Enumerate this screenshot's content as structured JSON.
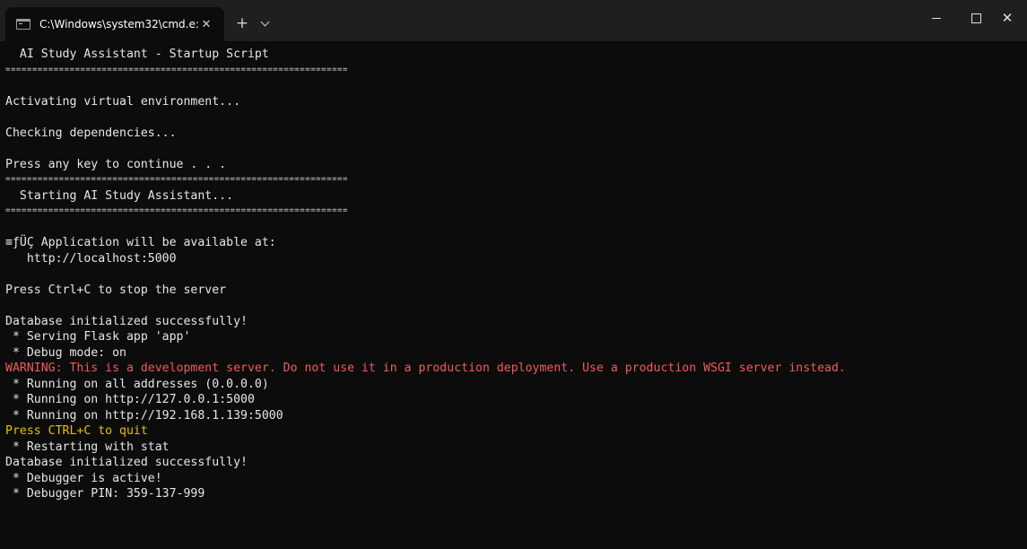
{
  "window": {
    "tab_title": "C:\\Windows\\system32\\cmd.e:",
    "close_tab_glyph": "✕",
    "new_tab_glyph": "+",
    "close_window_glyph": "✕"
  },
  "colors": {
    "background": "#0c0c0c",
    "titlebar": "#1f1f1f",
    "text": "#e6e6e6",
    "warning": "#f25a5a",
    "highlight": "#e5c000"
  },
  "console": {
    "lines": [
      "  AI Study Assistant - Startup Script",
      "================================================================",
      "",
      "Activating virtual environment...",
      "",
      "Checking dependencies...",
      "",
      "Press any key to continue . . .",
      "================================================================",
      "  Starting AI Study Assistant...",
      "================================================================",
      "",
      "≡ƒÜÇ Application will be available at:",
      "   http://localhost:5000",
      "",
      "Press Ctrl+C to stop the server",
      "",
      "Database initialized successfully!",
      " * Serving Flask app 'app'",
      " * Debug mode: on",
      "WARNING: This is a development server. Do not use it in a production deployment. Use a production WSGI server instead.",
      " * Running on all addresses (0.0.0.0)",
      " * Running on http://127.0.0.1:5000",
      " * Running on http://192.168.1.139:5000",
      "Press CTRL+C to quit",
      " * Restarting with stat",
      "Database initialized successfully!",
      " * Debugger is active!",
      " * Debugger PIN: 359-137-999"
    ]
  }
}
